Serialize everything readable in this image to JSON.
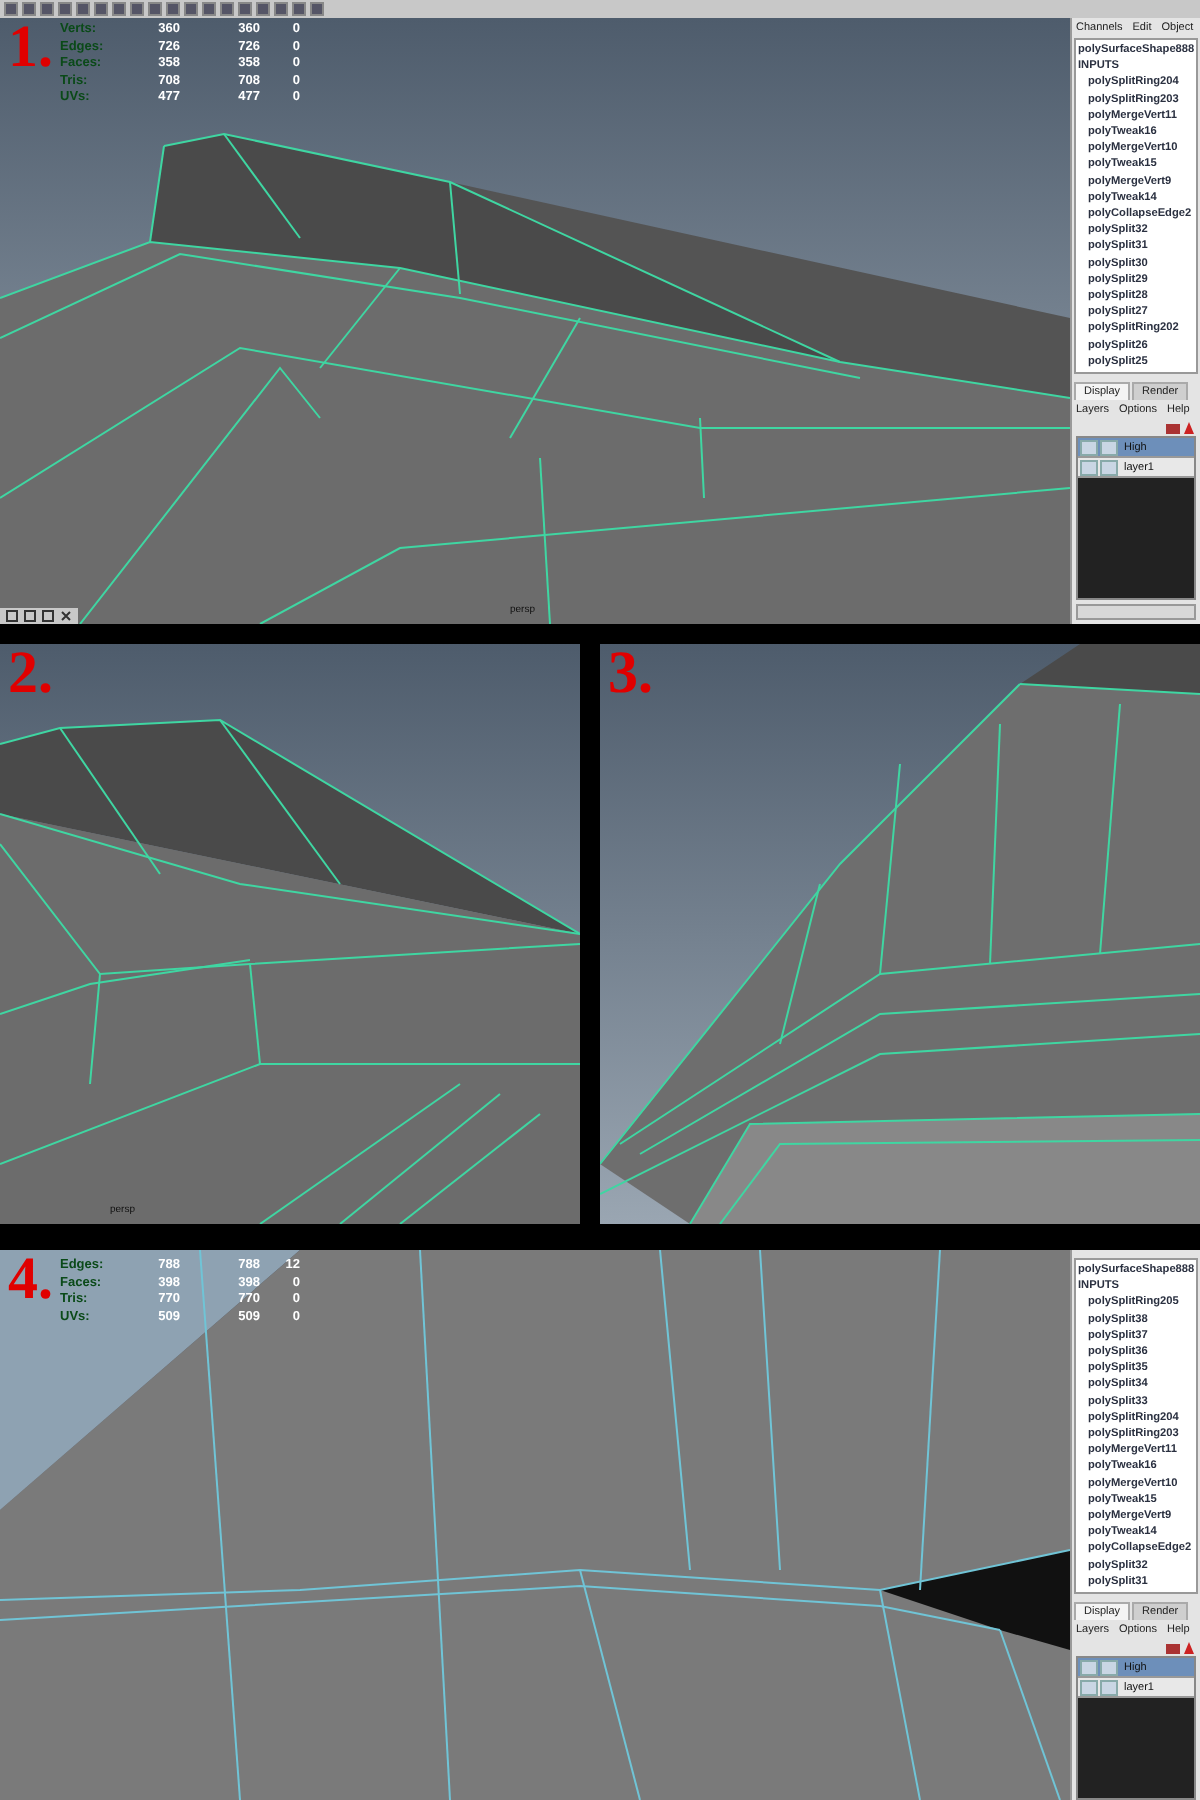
{
  "panels": [
    {
      "number": "1.",
      "hud": [
        {
          "label": "Verts:",
          "values": [
            "360",
            "360",
            "0"
          ]
        },
        {
          "label": "Edges:",
          "values": [
            "726",
            "726",
            "0"
          ]
        },
        {
          "label": "Faces:",
          "values": [
            "358",
            "358",
            "0"
          ]
        },
        {
          "label": "Tris:",
          "values": [
            "708",
            "708",
            "0"
          ]
        },
        {
          "label": "UVs:",
          "values": [
            "477",
            "477",
            "0"
          ]
        }
      ],
      "camera_label": "persp",
      "channel_box": {
        "menu": [
          "Channels",
          "Edit",
          "Object"
        ],
        "node": "polySurfaceShape888",
        "section": "INPUTS",
        "inputs": [
          "polySplitRing204",
          "polySplitRing203",
          "polyMergeVert11",
          "polyTweak16",
          "polyMergeVert10",
          "polyTweak15",
          "polyMergeVert9",
          "polyTweak14",
          "polyCollapseEdge2",
          "polySplit32",
          "polySplit31",
          "polySplit30",
          "polySplit29",
          "polySplit28",
          "polySplit27",
          "polySplitRing202",
          "polySplit26",
          "polySplit25"
        ]
      },
      "layer_editor": {
        "tabs": [
          {
            "label": "Display",
            "selected": true
          },
          {
            "label": "Render",
            "selected": false
          }
        ],
        "menu": [
          "Layers",
          "Options",
          "Help"
        ],
        "layers": [
          {
            "name": "High",
            "selected": true
          },
          {
            "name": "layer1",
            "selected": false
          }
        ]
      }
    },
    {
      "number": "2.",
      "camera_label": "persp"
    },
    {
      "number": "3."
    },
    {
      "number": "4.",
      "hud": [
        {
          "label": "Edges:",
          "values": [
            "788",
            "788",
            "12"
          ]
        },
        {
          "label": "Faces:",
          "values": [
            "398",
            "398",
            "0"
          ]
        },
        {
          "label": "Tris:",
          "values": [
            "770",
            "770",
            "0"
          ]
        },
        {
          "label": "UVs:",
          "values": [
            "509",
            "509",
            "0"
          ]
        }
      ],
      "channel_box": {
        "node": "polySurfaceShape888",
        "section": "INPUTS",
        "inputs": [
          "polySplitRing205",
          "polySplit38",
          "polySplit37",
          "polySplit36",
          "polySplit35",
          "polySplit34",
          "polySplit33",
          "polySplitRing204",
          "polySplitRing203",
          "polyMergeVert11",
          "polyTweak16",
          "polyMergeVert10",
          "polyTweak15",
          "polyMergeVert9",
          "polyTweak14",
          "polyCollapseEdge2",
          "polySplit32",
          "polySplit31"
        ]
      },
      "layer_editor": {
        "tabs": [
          {
            "label": "Display",
            "selected": true
          },
          {
            "label": "Render",
            "selected": false
          }
        ],
        "menu": [
          "Layers",
          "Options",
          "Help"
        ],
        "layers": [
          {
            "name": "High",
            "selected": true
          },
          {
            "name": "layer1",
            "selected": false
          }
        ]
      }
    }
  ]
}
